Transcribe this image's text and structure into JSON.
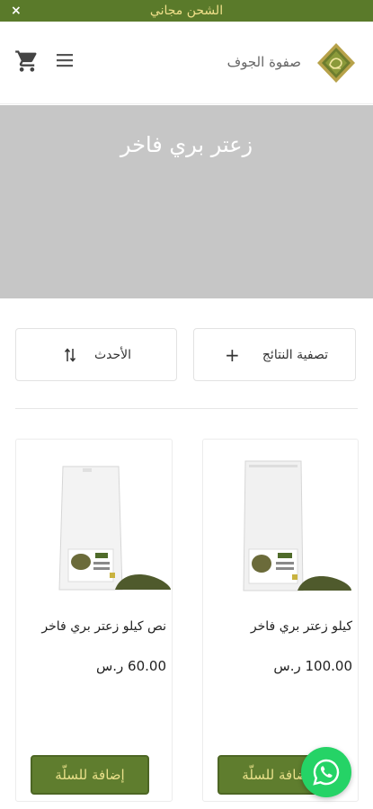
{
  "promo": {
    "close": "×",
    "text": "الشحن مجاني"
  },
  "header": {
    "brand_name": "صفوة الجوف",
    "cart_icon": "cart-icon",
    "menu_icon": "hamburger-menu-icon"
  },
  "hero": {
    "title": "زعتر بري فاخر"
  },
  "controls": {
    "filter_label": "تصفية النتائج",
    "filter_icon": "+",
    "sort_label": "الأحدث",
    "sort_icon": "sort-icon"
  },
  "products": [
    {
      "name": "كيلو زعتر بري فاخر",
      "price": "100.00 ر.س",
      "add_label": "إضافة للسلّة"
    },
    {
      "name": "نص كيلو زعتر بري فاخر",
      "price": "60.00 ر.س",
      "add_label": "إضافة للسلّة"
    }
  ],
  "colors": {
    "promo_bg": "#5a7a2a",
    "promo_text": "#f0e08a",
    "hero_bg": "#c6c6c6",
    "button_bg": "#5f7d2e",
    "button_text": "#e9e08a",
    "whatsapp": "#25d366"
  }
}
